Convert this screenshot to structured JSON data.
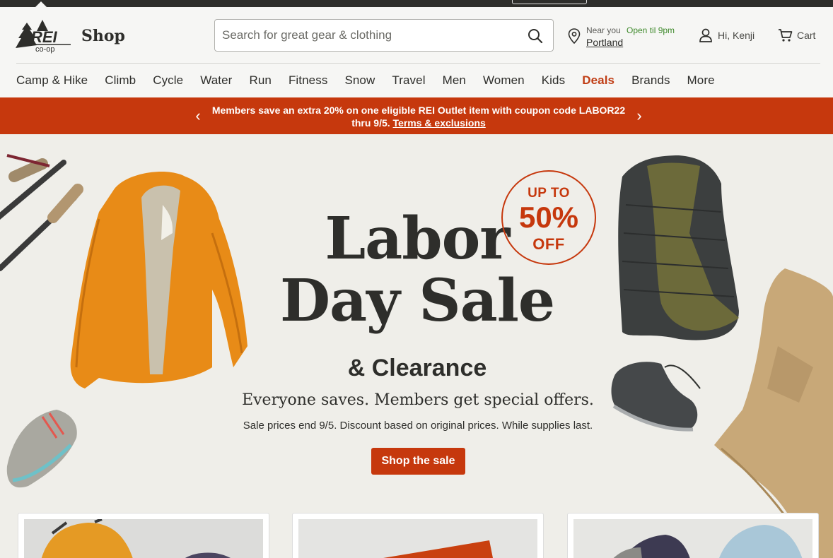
{
  "header": {
    "logo_text": "REI co-op",
    "shop_label": "Shop",
    "search": {
      "placeholder": "Search for great gear & clothing",
      "value": ""
    },
    "store": {
      "near_label": "Near you",
      "open_status": "Open til 9pm",
      "city": "Portland"
    },
    "account_label": "Hi, Kenji",
    "cart_label": "Cart"
  },
  "nav": {
    "items": [
      {
        "label": "Camp & Hike"
      },
      {
        "label": "Climb"
      },
      {
        "label": "Cycle"
      },
      {
        "label": "Water"
      },
      {
        "label": "Run"
      },
      {
        "label": "Fitness"
      },
      {
        "label": "Snow"
      },
      {
        "label": "Travel"
      },
      {
        "label": "Men"
      },
      {
        "label": "Women"
      },
      {
        "label": "Kids"
      },
      {
        "label": "Deals"
      },
      {
        "label": "Brands"
      },
      {
        "label": "More"
      }
    ]
  },
  "promo": {
    "message_line1": "Members save an extra 20% on one eligible REI Outlet item with coupon code LABOR22",
    "message_line2": "thru 9/5.",
    "link": "Terms & exclusions"
  },
  "hero": {
    "title_line1": "Labor",
    "title_line2": "Day Sale",
    "badge_line1": "UP TO",
    "badge_line2": "50%",
    "badge_line3": "OFF",
    "subtitle": "& Clearance",
    "tagline": "Everyone saves. Members get special offers.",
    "fineprint": "Sale prices end 9/5. Discount based on original prices. While supplies last.",
    "cta": "Shop the sale"
  },
  "colors": {
    "brand_red": "#c6380d",
    "text": "#2e2e2b",
    "hero_bg": "#efeee9",
    "open_green": "#3f8a2c"
  }
}
